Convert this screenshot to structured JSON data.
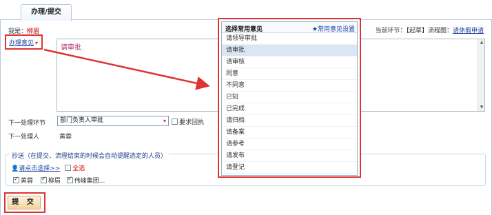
{
  "tab": {
    "label": "办理/提交"
  },
  "me": {
    "label": "我是：",
    "name": "柳眉"
  },
  "node": {
    "label": "当前环节：【起草】流程图：",
    "link": "请休假申请"
  },
  "opinion": {
    "link": "办理意见",
    "content": "请审批"
  },
  "next_step": {
    "label": "下一处理环节",
    "value": "部门负责人审批",
    "callback_label": "要求回执"
  },
  "next_handler": {
    "label": "下一处理人",
    "value": "黄蓉"
  },
  "cc": {
    "legend": "抄送（在提交、流程结束的时候会自动提醒选定的人员）",
    "pick_link": "请点击选择>>",
    "select_all": "全选",
    "people": [
      "黄蓉",
      "柳眉",
      "伟峰集团..."
    ]
  },
  "submit": {
    "label": "提 交"
  },
  "popup": {
    "title": "选择常用意见",
    "settings": "★常用意见设置",
    "items": [
      "请领导审批",
      "请审批",
      "请审核",
      "同意",
      "不同意",
      "已知",
      "已完成",
      "请归档",
      "请备案",
      "请参考",
      "请发布",
      "请登记"
    ],
    "selected_index": 1
  }
}
